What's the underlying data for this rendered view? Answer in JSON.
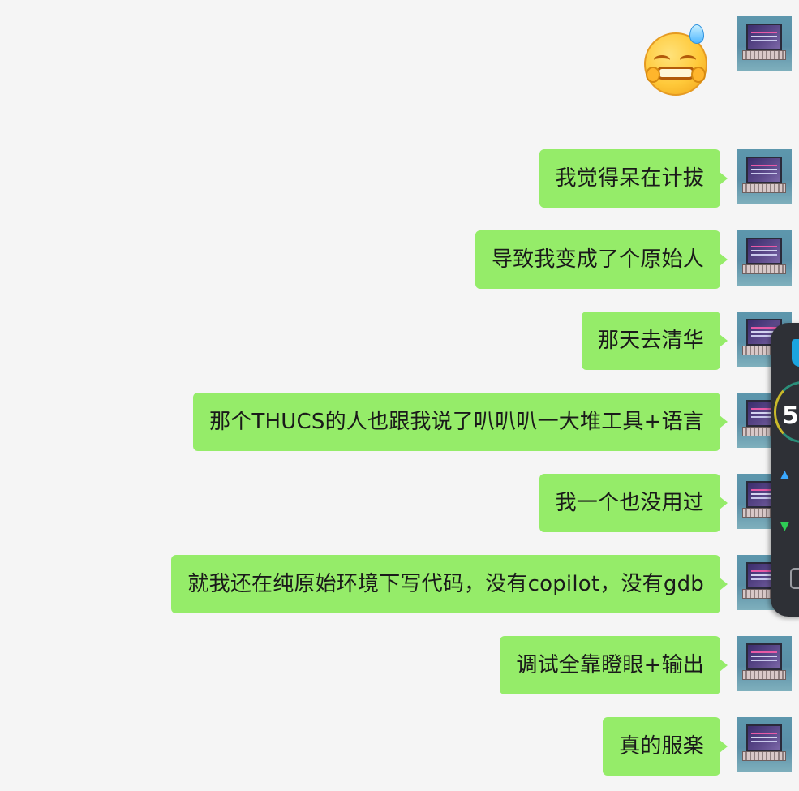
{
  "chat": {
    "sticker": {
      "icon": "sweat-smile-emoji-icon"
    },
    "messages": [
      {
        "text": "我觉得呆在计拔"
      },
      {
        "text": "导致我变成了个原始人"
      },
      {
        "text": "那天去清华"
      },
      {
        "text": "那个THUCS的人也跟我说了叭叭叭一大堆工具+语言"
      },
      {
        "text": "我一个也没用过"
      },
      {
        "text": "就我还在纯原始环境下写代码，没有copilot，没有gdb"
      },
      {
        "text": "调试全靠瞪眼+输出"
      },
      {
        "text": "真的服楽"
      }
    ],
    "bubble_color": "#95ec69",
    "background_color": "#f5f5f5"
  },
  "overlay": {
    "gauge_value": "5",
    "upload_icon": "up-arrow-icon",
    "download_icon": "down-arrow-icon",
    "shield_icon": "shield-icon",
    "box_icon": "box-icon"
  }
}
